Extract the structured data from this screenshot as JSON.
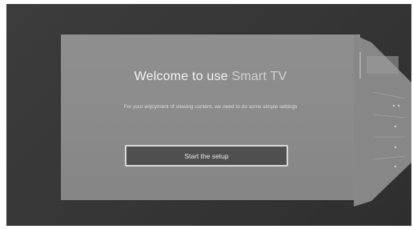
{
  "welcome": {
    "title_prefix": "Welcome to use",
    "title_brand": "Smart TV",
    "subtitle": "For your enjoyment of viewing content, we need to do some simple settings"
  },
  "actions": {
    "start_label": "Start the setup"
  },
  "side_panel": {
    "items": [
      {
        "label": "",
        "name": "side-item-1"
      },
      {
        "label": "",
        "name": "side-item-2"
      },
      {
        "label": "",
        "name": "side-item-3"
      },
      {
        "label": "",
        "name": "side-item-4"
      }
    ]
  },
  "colors": {
    "background": "#383838",
    "panel": "#8c8c8c",
    "button": "#4f4f4f",
    "button_border": "#d8d8d8"
  }
}
